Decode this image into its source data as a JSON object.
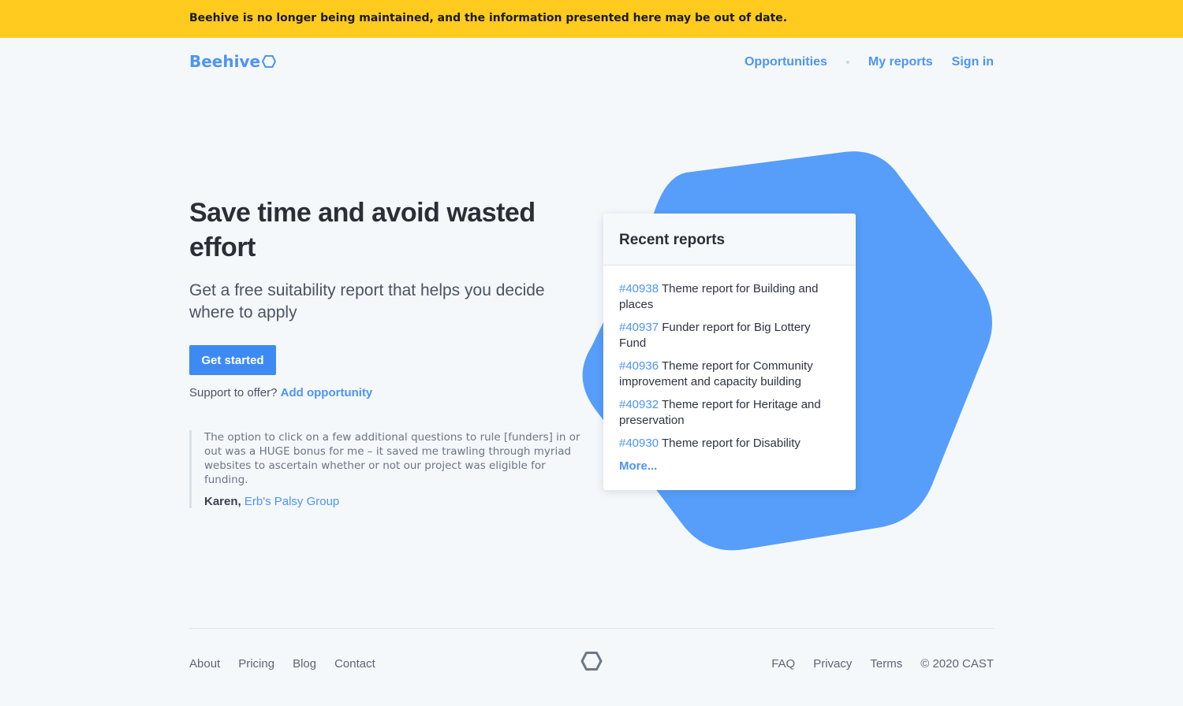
{
  "banner": {
    "text": "Beehive is no longer being maintained, and the information presented here may be out of date."
  },
  "header": {
    "logo_text": "Beehive",
    "nav": {
      "opportunities": "Opportunities",
      "my_reports": "My reports",
      "sign_in": "Sign in"
    }
  },
  "hero": {
    "title": "Save time and avoid wasted effort",
    "subtitle": "Get a free suitability report that helps you decide where to apply",
    "cta_label": "Get started",
    "support_text": "Support to offer?",
    "support_link": "Add opportunity"
  },
  "testimonial": {
    "quote": "The option to click on a few additional questions to rule [funders] in or out was a HUGE bonus for me – it saved me trawling through myriad websites to ascertain whether or not our project was eligible for funding.",
    "author": "Karen,",
    "organisation": "Erb's Palsy Group"
  },
  "recent_reports": {
    "title": "Recent reports",
    "items": [
      {
        "id": "#40938",
        "text": "Theme report for Building and places"
      },
      {
        "id": "#40937",
        "text": "Funder report for Big Lottery Fund"
      },
      {
        "id": "#40936",
        "text": "Theme report for Community improvement and capacity building"
      },
      {
        "id": "#40932",
        "text": "Theme report for Heritage and preservation"
      },
      {
        "id": "#40930",
        "text": "Theme report for Disability"
      }
    ],
    "more_label": "More..."
  },
  "footer": {
    "left": {
      "about": "About",
      "pricing": "Pricing",
      "blog": "Blog",
      "contact": "Contact"
    },
    "right": {
      "faq": "FAQ",
      "privacy": "Privacy",
      "terms": "Terms",
      "copyright": "© 2020 CAST"
    }
  },
  "colors": {
    "banner": "#ffcb1f",
    "accent": "#4d94f5",
    "button": "#3d8bf2",
    "blob": "#569ef9"
  },
  "icons": {
    "logo": "hexagon-icon",
    "footer": "hexagon-icon"
  }
}
